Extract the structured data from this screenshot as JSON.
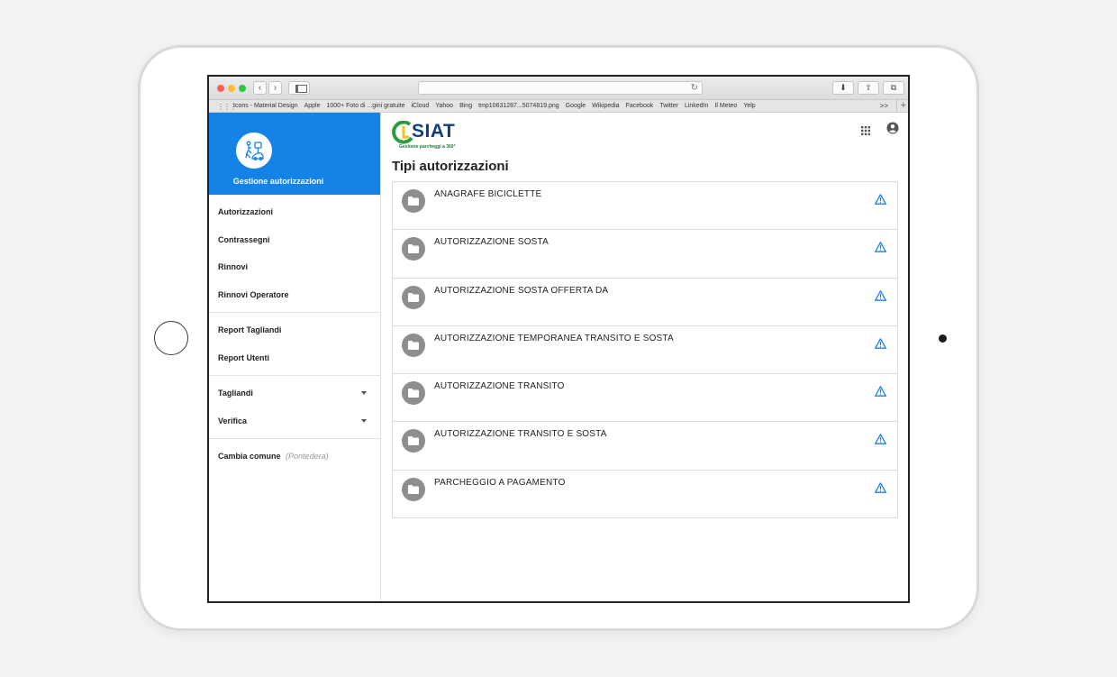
{
  "browser": {
    "nav_back": "‹",
    "nav_forward": "›",
    "reload": "↻",
    "download": "⬇",
    "share": "⇧",
    "tabs": "⧉",
    "bookmarks": [
      "Icons - Material Design",
      "Apple",
      "1000+ Foto di ...gini gratuite",
      "iCloud",
      "Yahoo",
      "Bing",
      "tmp10631287...5074819.png",
      "Google",
      "Wikipedia",
      "Facebook",
      "Twitter",
      "LinkedIn",
      "Il Meteo",
      "Yelp"
    ],
    "bookmarks_more": ">>",
    "bookmarks_add": "+"
  },
  "sidebar": {
    "title": "Gestione autorizzazioni",
    "groups": [
      {
        "items": [
          {
            "label": "Autorizzazioni"
          },
          {
            "label": "Contrassegni"
          },
          {
            "label": "Rinnovi"
          },
          {
            "label": "Rinnovi Operatore"
          }
        ]
      },
      {
        "items": [
          {
            "label": "Report Tagliandi"
          },
          {
            "label": "Report Utenti"
          }
        ]
      },
      {
        "items": [
          {
            "label": "Tagliandi",
            "expandable": true
          },
          {
            "label": "Verifica",
            "expandable": true
          }
        ]
      }
    ],
    "comune": {
      "label": "Cambia comune",
      "current": "(Pontedera)"
    }
  },
  "brand": {
    "name": "SIAT",
    "tagline": "Gestione parcheggi a 360°"
  },
  "page": {
    "title": "Tipi autorizzazioni",
    "items": [
      {
        "label": "ANAGRAFE BICICLETTE"
      },
      {
        "label": "AUTORIZZAZIONE SOSTA"
      },
      {
        "label": "AUTORIZZAZIONE SOSTA OFFERTA DA"
      },
      {
        "label": "AUTORIZZAZIONE TEMPORANEA TRANSITO E SOSTA"
      },
      {
        "label": "AUTORIZZAZIONE TRANSITO"
      },
      {
        "label": "AUTORIZZAZIONE TRANSITO E SOSTA"
      },
      {
        "label": "PARCHEGGIO A PAGAMENTO"
      }
    ]
  },
  "colors": {
    "sidebar_header": "#1583e6",
    "warning_icon": "#1583e6",
    "folder_avatar": "#8e8e8e",
    "brand_blue": "#123f7c",
    "brand_green": "#1f7a3b"
  },
  "icons": {
    "sidebar_logo": "parking-person-icon",
    "apps": "apps-grid-icon",
    "account": "account-circle-icon",
    "list_item": "folder-icon",
    "list_action": "warning-triangle-icon"
  }
}
